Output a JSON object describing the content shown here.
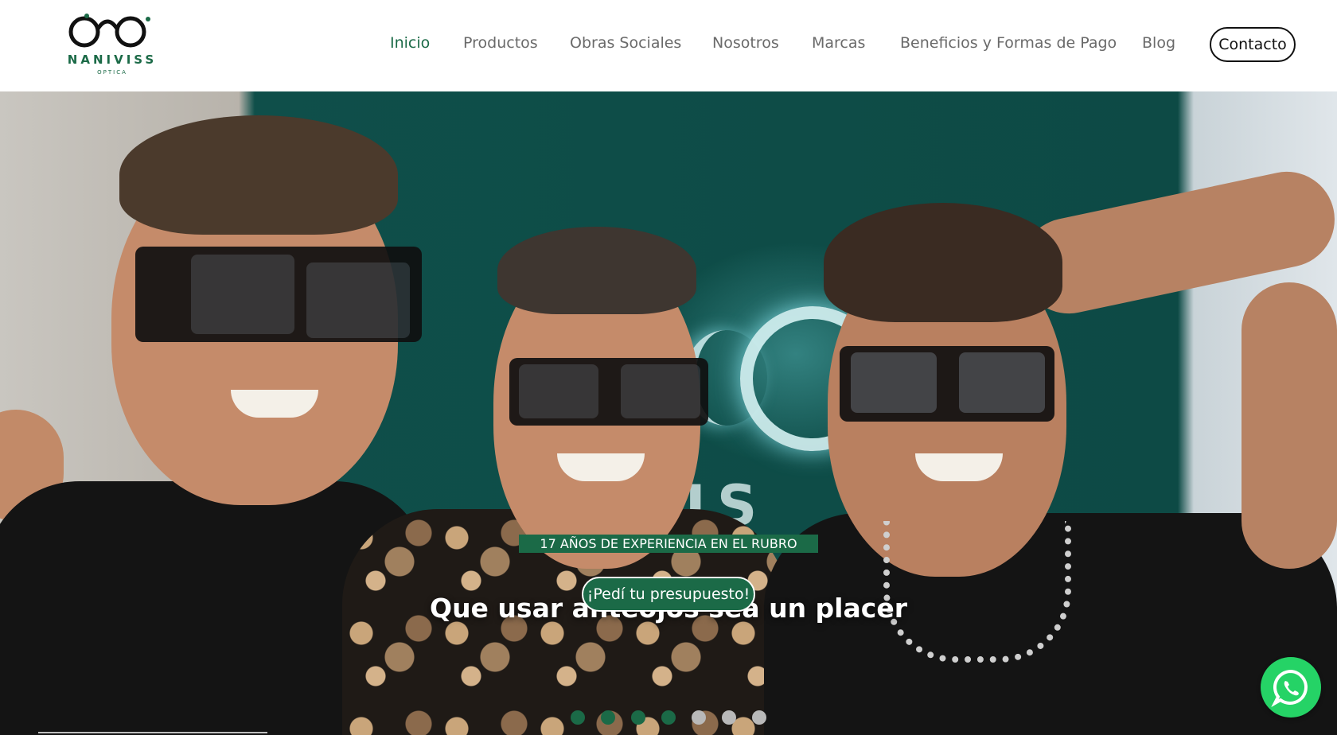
{
  "brand": {
    "name": "NANIVISS",
    "subtitle": "OPTICA",
    "color": "#1b6a47"
  },
  "nav": {
    "items": [
      {
        "label": "Inicio",
        "active": true
      },
      {
        "label": "Productos",
        "active": false
      },
      {
        "label": "Obras Sociales",
        "active": false
      },
      {
        "label": "Nosotros",
        "active": false
      },
      {
        "label": "Marcas",
        "active": false
      },
      {
        "label": "Beneficios y Formas de Pago",
        "active": false
      },
      {
        "label": "Blog",
        "active": false
      }
    ],
    "contact_label": "Contacto"
  },
  "hero": {
    "title": "Que usar anteojos sea un placer",
    "subtitle": "17 AÑOS DE EXPERIENCIA EN EL RUBRO",
    "cta_label": "¡Pedí tu presupuesto!",
    "background_sign_text": "NIVIS",
    "slides_total": 7,
    "active_slide": 4
  },
  "floating": {
    "whatsapp_icon": "whatsapp-icon"
  }
}
